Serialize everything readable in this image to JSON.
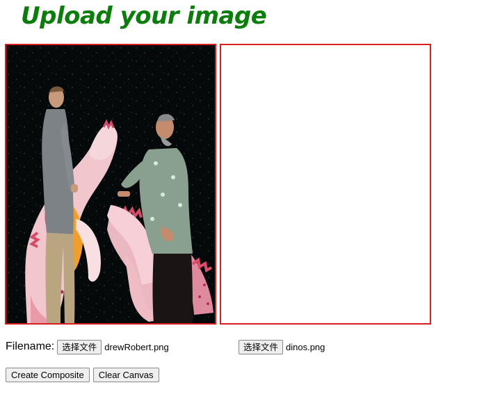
{
  "page": {
    "title": "Upload your image"
  },
  "canvases": {
    "left": {
      "name": "composite-source-canvas"
    },
    "right": {
      "name": "composite-result-canvas"
    }
  },
  "upload_1": {
    "label": "Filename:",
    "button_label": "选择文件",
    "file_name": "drewRobert.png"
  },
  "upload_2": {
    "button_label": "选择文件",
    "file_name": "dinos.png"
  },
  "actions": {
    "create_label": "Create Composite",
    "clear_label": "Clear Canvas"
  },
  "colors": {
    "title": "#0a7d0a",
    "canvas_border": "#d81e1e"
  }
}
